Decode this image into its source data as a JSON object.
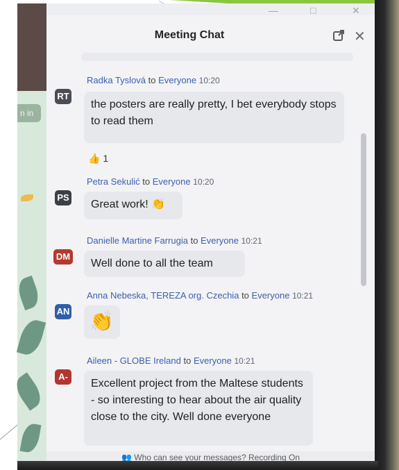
{
  "chat": {
    "title": "Meeting Chat",
    "popout_icon": "popout-icon",
    "close_icon": "close-icon"
  },
  "background": {
    "join_chip": "n in"
  },
  "messages": [
    {
      "initials": "RT",
      "avatar_color": "#4a4d53",
      "sender": "Radka Tyslová",
      "to_word": "to",
      "audience": "Everyone",
      "time": "10:20",
      "text": "the posters are really pretty, I bet everybody stops to read them",
      "reaction_icon": "thumbs-up-icon",
      "reaction_count": "1"
    },
    {
      "initials": "PS",
      "avatar_color": "#3a3f48",
      "sender": "Petra Sekulić",
      "to_word": "to",
      "audience": "Everyone",
      "time": "10:20",
      "text": "Great work!",
      "emoji": "clap-icon"
    },
    {
      "initials": "DM",
      "avatar_color": "#b23a2e",
      "sender": "Danielle Martine Farrugia",
      "to_word": "to",
      "audience": "Everyone",
      "time": "10:21",
      "text": "Well done to all the team"
    },
    {
      "initials": "AN",
      "avatar_color": "#2f5ea8",
      "sender": "Anna Nebeska, TEREZA org. Czechia",
      "to_word": "to",
      "audience": "Everyone",
      "time": "10:21",
      "emoji": "clap-icon"
    },
    {
      "initials": "A-",
      "avatar_color": "#b2362e",
      "sender": "Aileen - GLOBE Ireland",
      "to_word": "to",
      "audience": "Everyone",
      "time": "10:21",
      "text": "Excellent project from the Maltese students - so interesting to hear about the air quality close to the city. Well done everyone"
    }
  ],
  "footer": {
    "icon": "people-icon",
    "text": "Who can see your messages? Recording On"
  },
  "colors": {
    "accent_link": "#3a5fb0",
    "bubble": "#e7e8ec",
    "slide_green": "#8cc63f"
  }
}
